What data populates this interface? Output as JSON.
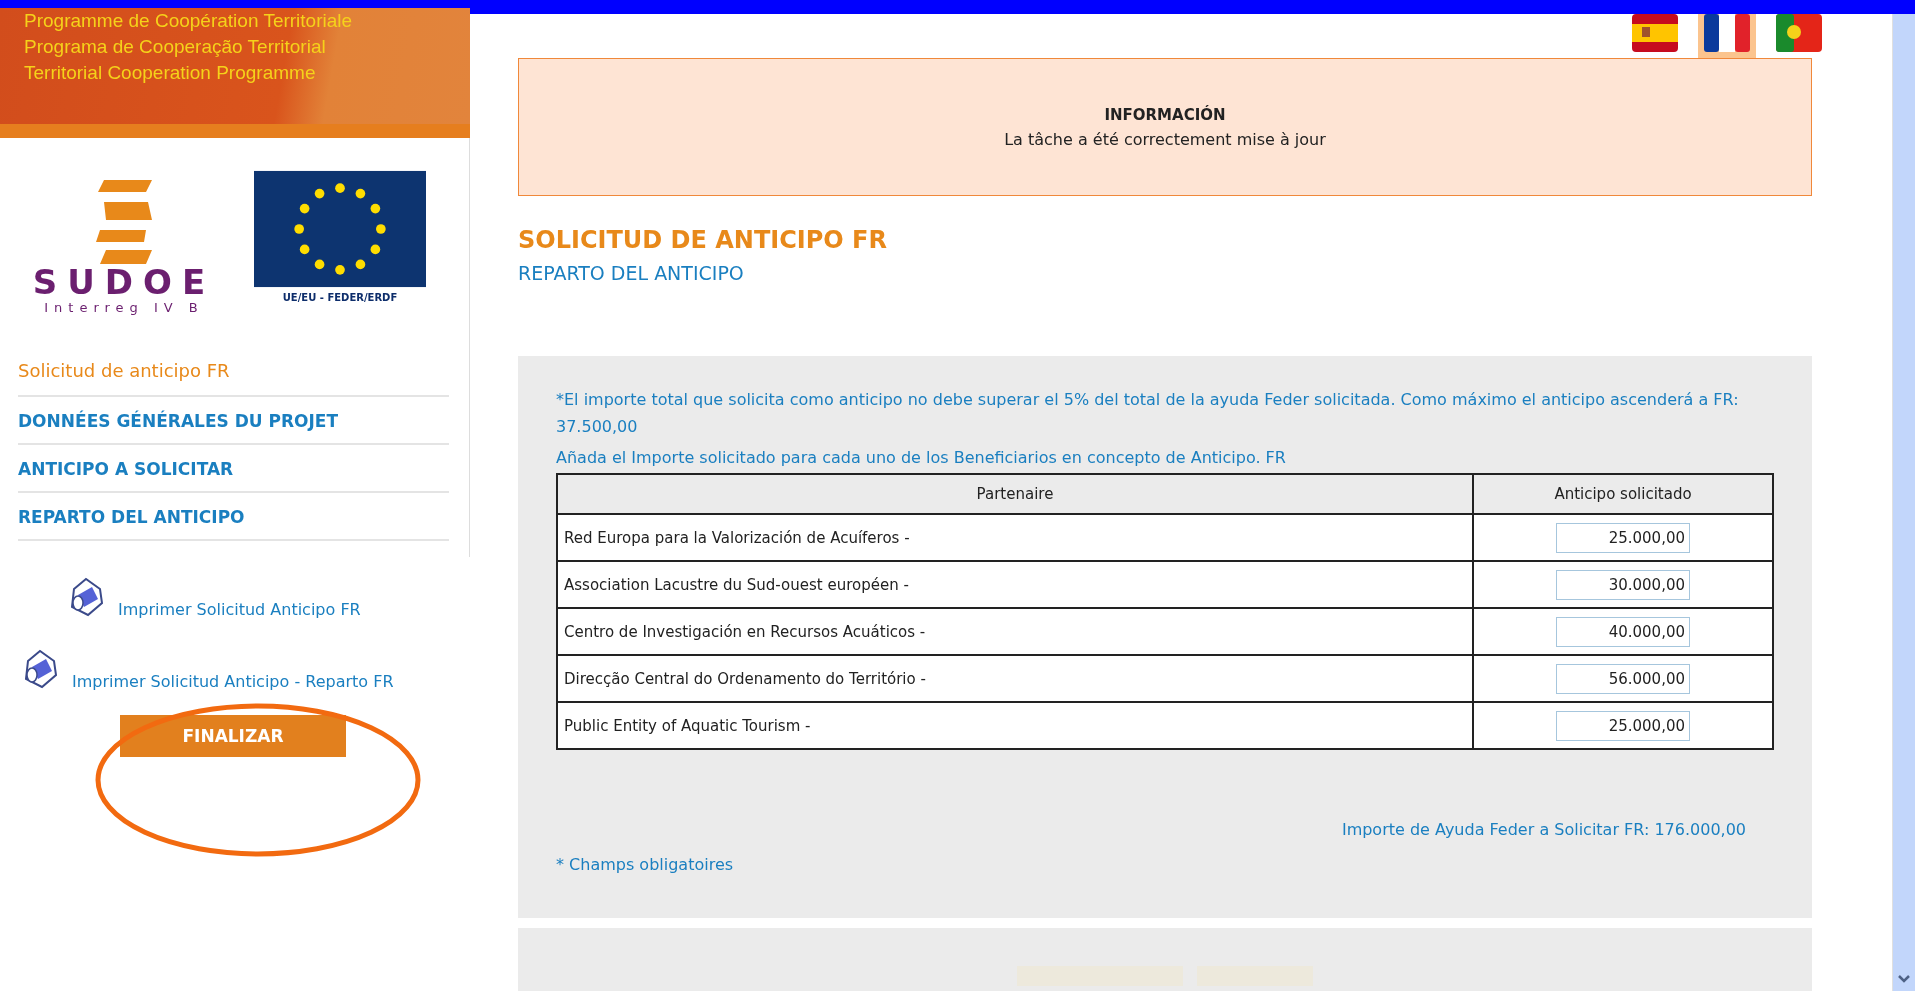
{
  "banner": {
    "lines": [
      "Programme de Coopération Territoriale",
      "Programa de Cooperação Territorial",
      "Territorial Cooperation Programme"
    ]
  },
  "logos": {
    "sudoe_name": "SUDOE",
    "sudoe_sub": "Interreg IV B",
    "eu_caption": "UE/EU - FEDER/ERDF"
  },
  "sidebar": {
    "title": "Solicitud de anticipo FR",
    "items": [
      {
        "label": "DONNÉES GÉNÉRALES DU PROJET",
        "selected": false
      },
      {
        "label": "ANTICIPO A SOLICITAR",
        "selected": false
      },
      {
        "label": "REPARTO DEL ANTICIPO",
        "selected": false
      }
    ],
    "print_links": [
      {
        "label": "Imprimer Solicitud Anticipo FR",
        "indented": true
      },
      {
        "label": "Imprimer Solicitud Anticipo - Reparto FR",
        "indented": false
      }
    ],
    "finish_button": "FINALIZAR"
  },
  "languages": [
    {
      "kind": "es",
      "selected": false
    },
    {
      "kind": "fr",
      "selected": true
    },
    {
      "kind": "pt",
      "selected": false
    }
  ],
  "info": {
    "title": "INFORMACIÓN",
    "message": "La tâche a été correctement mise à jour"
  },
  "page_title": "SOLICITUD DE ANTICIPO FR",
  "page_subtitle": "REPARTO DEL ANTICIPO",
  "form": {
    "note": "*El importe total que solicita como anticipo no debe superar el 5% del total de la ayuda Feder solicitada. Como máximo el anticipo ascenderá a FR: 37.500,00",
    "instruction": "Añada el Importe solicitado para cada uno de los Beneficiarios en concepto de Anticipo. FR",
    "table": {
      "columns": [
        "Partenaire",
        "Anticipo solicitado"
      ],
      "rows": [
        {
          "partner": "Red Europa para la Valorización de Acuíferos -",
          "amount": "25.000,00"
        },
        {
          "partner": "Association Lacustre du Sud-ouest européen -",
          "amount": "30.000,00"
        },
        {
          "partner": "Centro de Investigación en Recursos Acuáticos -",
          "amount": "40.000,00"
        },
        {
          "partner": "Direcção Central do Ordenamento do Território -",
          "amount": "56.000,00"
        },
        {
          "partner": "Public Entity of Aquatic Tourism -",
          "amount": "25.000,00"
        }
      ]
    },
    "total": "Importe de Ayuda Feder a Solicitar FR: 176.000,00",
    "required_note": "* Champs obligatoires"
  }
}
